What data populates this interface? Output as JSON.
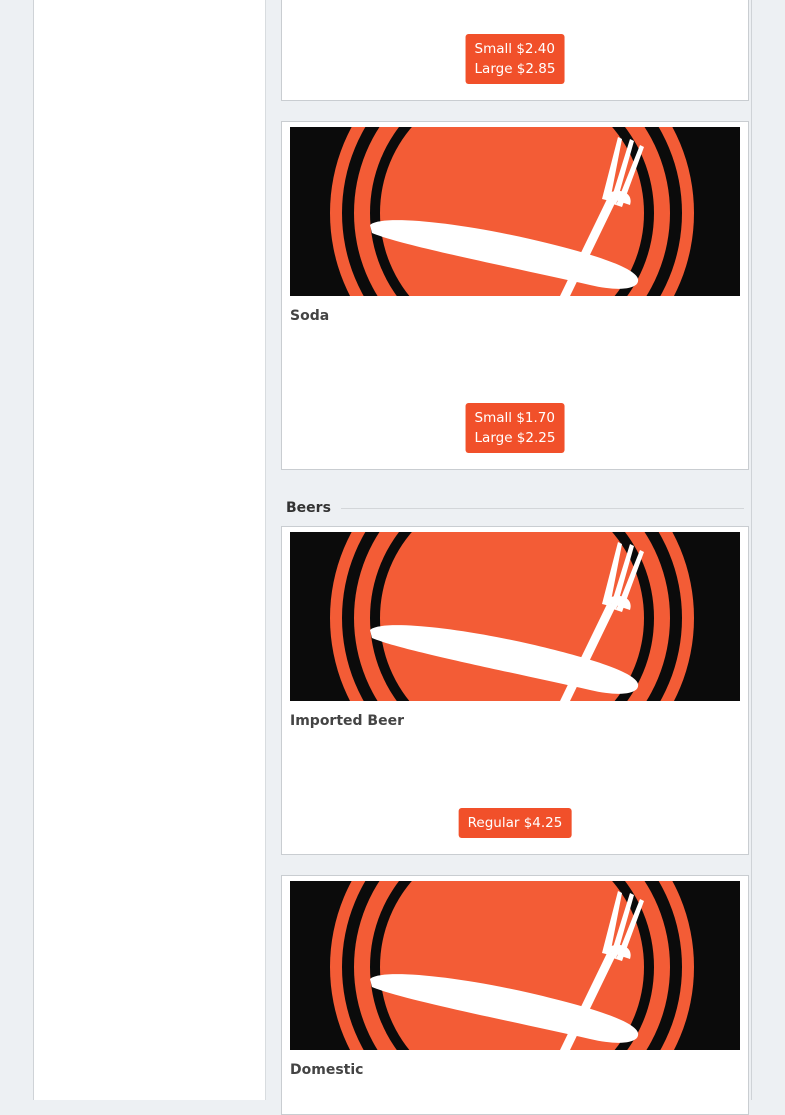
{
  "menu": {
    "items": [
      {
        "name": "",
        "prices": [
          "Small $2.40",
          "Large $2.85"
        ]
      },
      {
        "name": "Soda",
        "prices": [
          "Small $1.70",
          "Large $2.25"
        ]
      }
    ],
    "sections": [
      {
        "title": "Beers",
        "items": [
          {
            "name": "Imported Beer",
            "prices": [
              "Regular $4.25"
            ]
          },
          {
            "name": "Domestic",
            "prices": []
          }
        ]
      }
    ]
  },
  "colors": {
    "accent": "#f1502a",
    "plate_orange": "#f35c36",
    "background": "#edf0f3"
  },
  "icons": {
    "item_image": "plate-fork-knife-logo"
  }
}
